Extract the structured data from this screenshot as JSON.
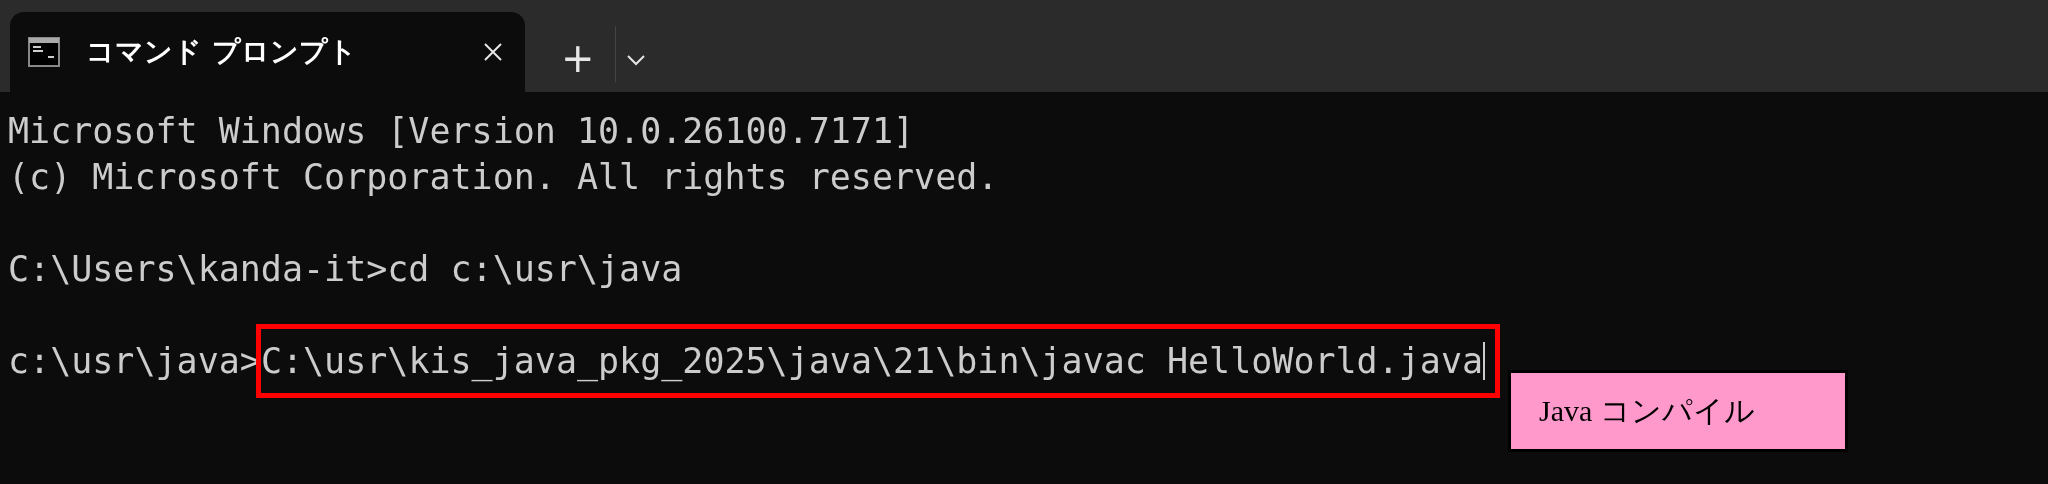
{
  "tabs": [
    {
      "title": "コマンド プロンプト",
      "selected": true
    }
  ],
  "new_tab_button": "+",
  "terminal": {
    "lines": [
      {
        "kind": "text",
        "text": "Microsoft Windows [Version 10.0.26100.7171]"
      },
      {
        "kind": "text",
        "text": "(c) Microsoft Corporation. All rights reserved."
      },
      {
        "kind": "blank"
      },
      {
        "kind": "prompt",
        "prompt": "C:\\Users\\kanda-it>",
        "command": "cd c:\\usr\\java",
        "highlighted": false
      },
      {
        "kind": "blank"
      },
      {
        "kind": "prompt",
        "prompt": "c:\\usr\\java>",
        "command": "C:\\usr\\kis_java_pkg_2025\\java\\21\\bin\\javac HelloWorld.java",
        "highlighted": true,
        "cursor": true
      }
    ]
  },
  "callout": {
    "text": "Java コンパイル"
  }
}
